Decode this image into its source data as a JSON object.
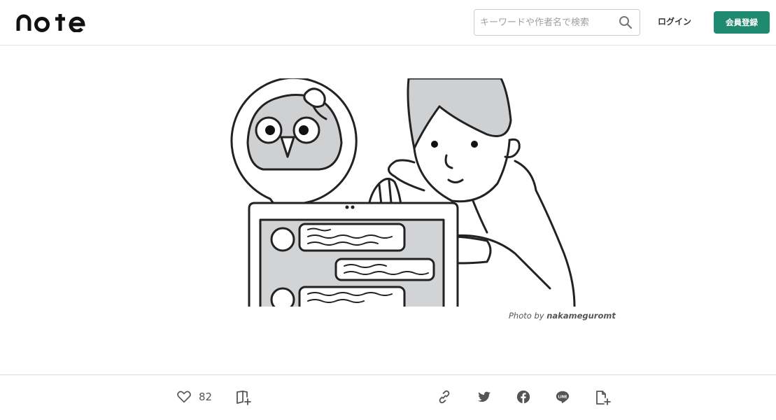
{
  "header": {
    "logo": "note",
    "search": {
      "placeholder": "キーワードや作者名で検索",
      "icon": "search-icon"
    },
    "login_label": "ログイン",
    "signup_label": "会員登録"
  },
  "hero": {
    "credit_prefix": "Photo by",
    "credit_author": "nakameguromt"
  },
  "actions": {
    "like_count": "82",
    "like_icon": "heart-icon",
    "magazine_icon": "magazine-add-icon",
    "share_icons": [
      "link-icon",
      "twitter-icon",
      "facebook-icon",
      "line-icon",
      "embed-icon"
    ]
  },
  "colors": {
    "accent": "#1f8a70",
    "text": "#222222",
    "muted": "#555555",
    "border": "#e3e3e3"
  }
}
